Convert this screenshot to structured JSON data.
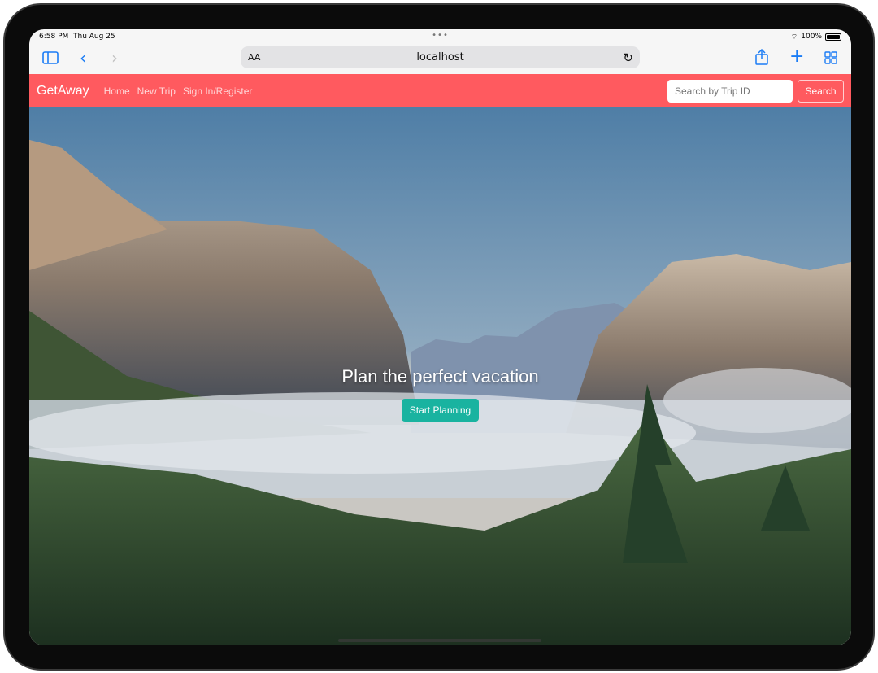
{
  "status_bar": {
    "time": "6:58 PM",
    "date": "Thu Aug 25",
    "battery": "100%"
  },
  "browser": {
    "url": "localhost",
    "text_size_label": "AA"
  },
  "navbar": {
    "brand": "GetAway",
    "links": [
      "Home",
      "New Trip",
      "Sign In/Register"
    ],
    "search_placeholder": "Search by Trip ID",
    "search_button": "Search",
    "color": "#ff5a5f"
  },
  "hero": {
    "title": "Plan the perfect vacation",
    "cta": "Start Planning",
    "cta_color": "#19b3a0"
  }
}
